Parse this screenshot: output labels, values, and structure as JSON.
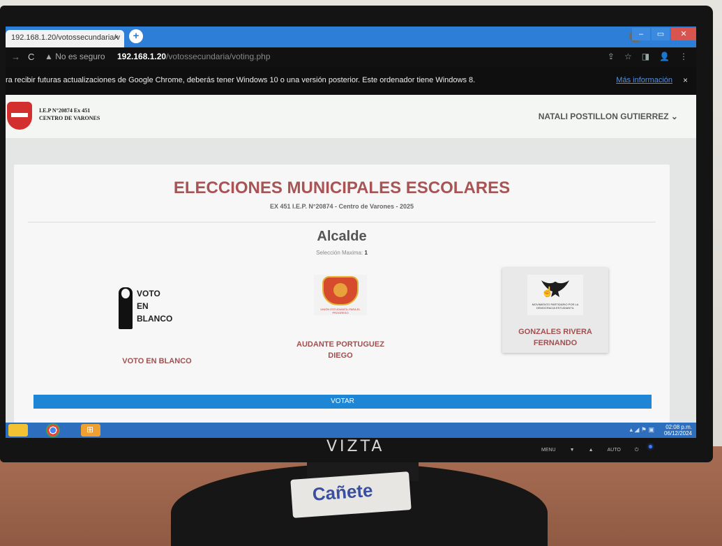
{
  "browser": {
    "tab_title": "192.168.1.20/votossecundaria/v",
    "tab_close": "×",
    "new_tab": "+",
    "not_secure": "▲ No es seguro",
    "url_host": "192.168.1.20",
    "url_path": "/votossecundaria/voting.php",
    "info_message": "ra recibir futuras actualizaciones de Google Chrome, deberás tener Windows 10 o una versión posterior. Este ordenador tiene Windows 8.",
    "info_more": "Más información",
    "info_close": "×"
  },
  "header": {
    "school_line1": "I.E.P N°20874 Ex 451",
    "school_line2": "CENTRO DE VARONES",
    "user_name": "NATALI POSTILLON GUTIERREZ ⌄"
  },
  "election": {
    "title": "ELECCIONES MUNICIPALES ESCOLARES",
    "subtitle": "EX 451 I.E.P. N°20874 - Centro de Varones - 2025",
    "position": "Alcalde",
    "max_label": "Selección Maxima:",
    "max_value": "1",
    "candidates": [
      {
        "name": "VOTO EN BLANCO",
        "logo_text": [
          "VOTO",
          "EN",
          "BLANCO"
        ]
      },
      {
        "name_line1": "AUDANTE PORTUGUEZ",
        "name_line2": "DIEGO",
        "logo_caption": "UNIÓN ESTUDIANTIL PARA EL PROGRESO"
      },
      {
        "name_line1": "GONZALES RIVERA",
        "name_line2": "FERNANDO",
        "logo_caption": "MOVIMIENTO PARTIDARIO POR LA DEMOCRACIA ESTUDIANTIL"
      }
    ],
    "vote_button": "VOTAR"
  },
  "taskbar": {
    "time": "02:08 p.m.",
    "date": "06/12/2024"
  },
  "monitor": {
    "brand": "VIZTA",
    "buttons": [
      "MENU",
      "▼",
      "▲",
      "AUTO",
      "⏻"
    ]
  },
  "desk": {
    "sticker": "Cañete"
  }
}
